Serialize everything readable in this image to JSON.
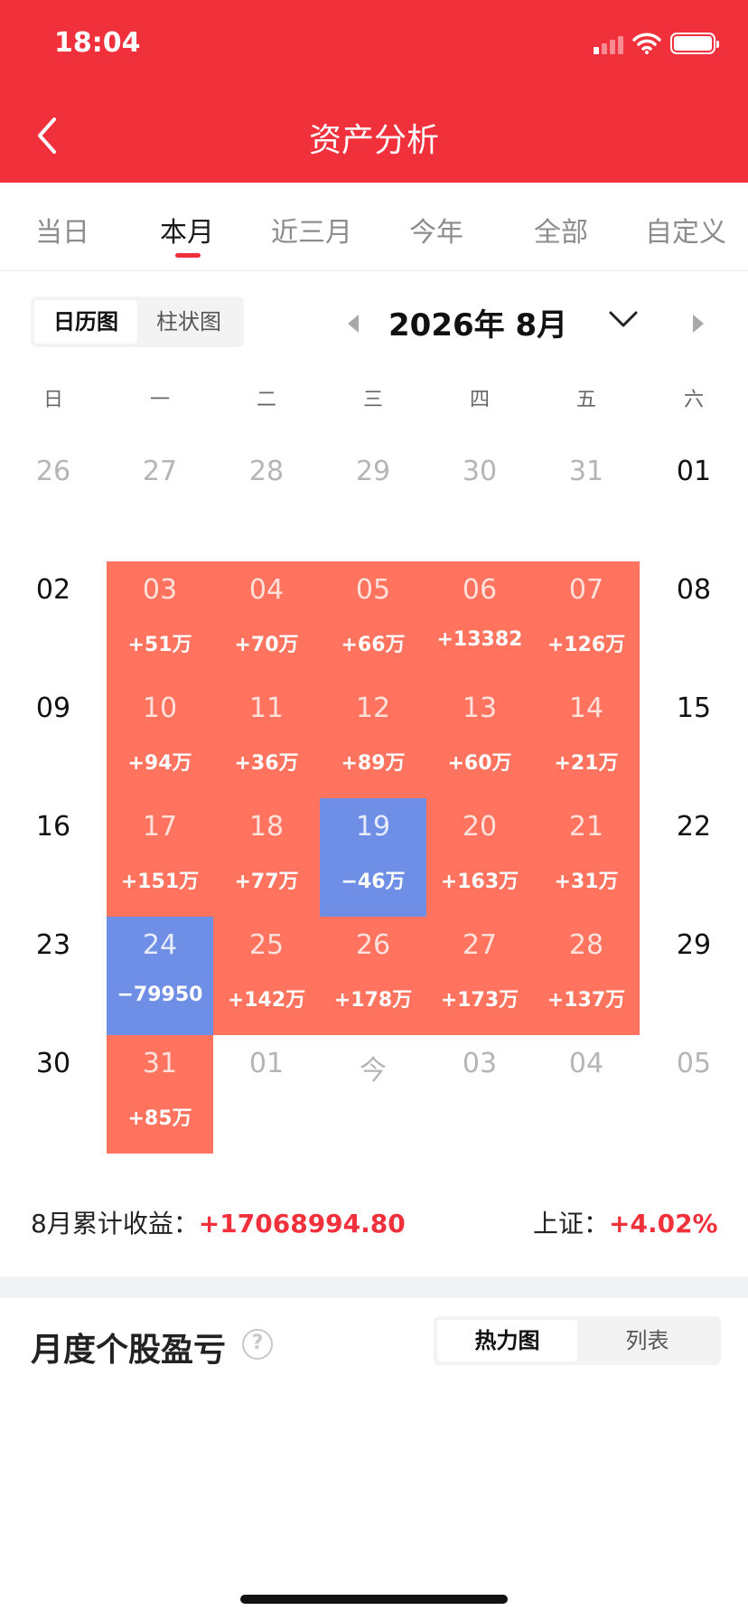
{
  "status_bar": {
    "time": "18:04"
  },
  "header": {
    "title": "资产分析"
  },
  "tabs": [
    "当日",
    "本月",
    "近三月",
    "今年",
    "全部",
    "自定义"
  ],
  "view_toggle": {
    "options": [
      "日历图",
      "柱状图"
    ],
    "selected": "日历图"
  },
  "month": {
    "label": "2026年 8月"
  },
  "weekdays": [
    "日",
    "一",
    "二",
    "三",
    "四",
    "五",
    "六"
  ],
  "calendar": [
    [
      {
        "day": "26",
        "state": "outside"
      },
      {
        "day": "27",
        "state": "outside"
      },
      {
        "day": "28",
        "state": "outside"
      },
      {
        "day": "29",
        "state": "outside"
      },
      {
        "day": "30",
        "state": "outside"
      },
      {
        "day": "31",
        "state": "outside"
      },
      {
        "day": "01",
        "state": "plain"
      }
    ],
    [
      {
        "day": "02",
        "state": "plain"
      },
      {
        "day": "03",
        "pl": "+51万",
        "state": "up"
      },
      {
        "day": "04",
        "pl": "+70万",
        "state": "up"
      },
      {
        "day": "05",
        "pl": "+66万",
        "state": "up"
      },
      {
        "day": "06",
        "pl": "+13382",
        "state": "up"
      },
      {
        "day": "07",
        "pl": "+126万",
        "state": "up"
      },
      {
        "day": "08",
        "state": "plain"
      }
    ],
    [
      {
        "day": "09",
        "state": "plain"
      },
      {
        "day": "10",
        "pl": "+94万",
        "state": "up"
      },
      {
        "day": "11",
        "pl": "+36万",
        "state": "up"
      },
      {
        "day": "12",
        "pl": "+89万",
        "state": "up"
      },
      {
        "day": "13",
        "pl": "+60万",
        "state": "up"
      },
      {
        "day": "14",
        "pl": "+21万",
        "state": "up"
      },
      {
        "day": "15",
        "state": "plain"
      }
    ],
    [
      {
        "day": "16",
        "state": "plain"
      },
      {
        "day": "17",
        "pl": "+151万",
        "state": "up"
      },
      {
        "day": "18",
        "pl": "+77万",
        "state": "up"
      },
      {
        "day": "19",
        "pl": "−46万",
        "state": "down"
      },
      {
        "day": "20",
        "pl": "+163万",
        "state": "up"
      },
      {
        "day": "21",
        "pl": "+31万",
        "state": "up"
      },
      {
        "day": "22",
        "state": "plain"
      }
    ],
    [
      {
        "day": "23",
        "state": "plain"
      },
      {
        "day": "24",
        "pl": "−79950",
        "state": "down"
      },
      {
        "day": "25",
        "pl": "+142万",
        "state": "up"
      },
      {
        "day": "26",
        "pl": "+178万",
        "state": "up"
      },
      {
        "day": "27",
        "pl": "+173万",
        "state": "up"
      },
      {
        "day": "28",
        "pl": "+137万",
        "state": "up"
      },
      {
        "day": "29",
        "state": "plain"
      }
    ],
    [
      {
        "day": "30",
        "state": "plain"
      },
      {
        "day": "31",
        "pl": "+85万",
        "state": "up"
      },
      {
        "day": "01",
        "state": "outside"
      },
      {
        "day": "今",
        "state": "outside"
      },
      {
        "day": "03",
        "state": "outside"
      },
      {
        "day": "04",
        "state": "outside"
      },
      {
        "day": "05",
        "state": "outside"
      }
    ]
  ],
  "summary": {
    "monthly_label": "8月累计收益：",
    "monthly_value": "+17068994.80",
    "index_label": "上证：",
    "index_value": "+4.02%"
  },
  "section": {
    "title": "月度个股盈亏",
    "help_glyph": "?",
    "toggle_options": [
      "热力图",
      "列表"
    ],
    "toggle_selected": "热力图"
  },
  "colors": {
    "brand_red": "#f0303a",
    "gain": "#ff735f",
    "loss": "#6f8fe6"
  }
}
